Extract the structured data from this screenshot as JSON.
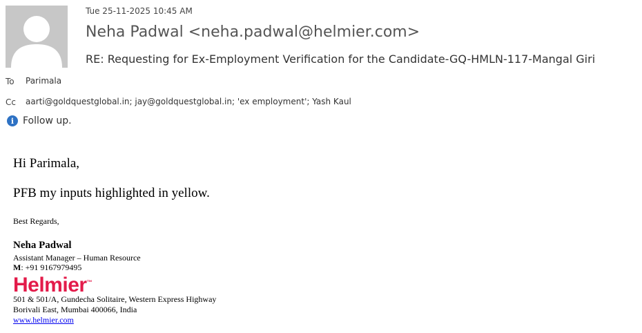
{
  "header": {
    "date": "Tue 25-11-2025 10:45 AM",
    "sender": "Neha Padwal <neha.padwal@helmier.com>",
    "subject": "RE: Requesting for Ex-Employment Verification for the Candidate-GQ-HMLN-117-Mangal Giri",
    "to_label": "To",
    "to_value": "Parimala",
    "cc_label": "Cc",
    "cc_value": "aarti@goldquestglobal.in; jay@goldquestglobal.in; 'ex employment'; Yash Kaul",
    "followup": "Follow up.",
    "info_icon": "info-icon"
  },
  "body": {
    "greeting": "Hi Parimala,",
    "message": "PFB my inputs highlighted in yellow.",
    "closing": "Best Regards,"
  },
  "signature": {
    "name": "Neha Padwal",
    "title": "Assistant Manager – Human Resource",
    "mobile_label": "M",
    "mobile": ":  +91 9167979495",
    "logo_text": "Helmier",
    "logo_mark": "™",
    "address1": "501 & 501/A, Gundecha Solitaire, Western Express Highway",
    "address2": "Borivali East, Mumbai 400066, India",
    "website": "www.helmier.com"
  },
  "colors": {
    "logo": "#e31b4a",
    "info_icon": "#2e72c4",
    "link": "#0000ee"
  }
}
